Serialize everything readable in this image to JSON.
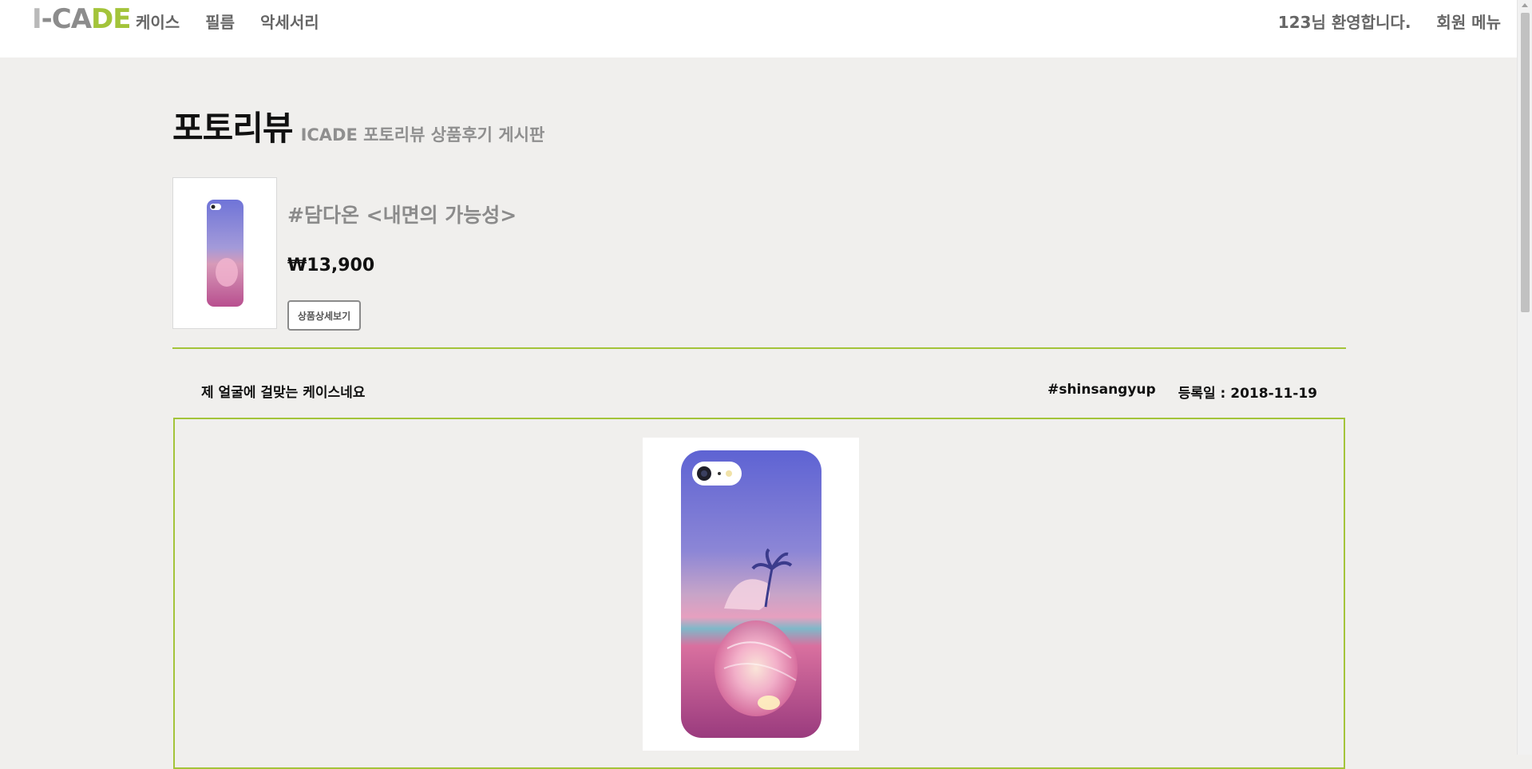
{
  "header": {
    "logo": {
      "part1": "I",
      "part2": "-CA",
      "part3": "DE"
    },
    "nav": [
      "케이스",
      "필름",
      "악세서리"
    ],
    "welcome": "123님 환영합니다.",
    "member_menu": "회원 메뉴"
  },
  "page": {
    "title": "포토리뷰",
    "subtitle": "ICADE 포토리뷰 상품후기 게시판"
  },
  "product": {
    "name": "#담다온 <내면의 가능성>",
    "price": "₩13,900",
    "detail_button": "상품상세보기"
  },
  "review": {
    "title": "제 얼굴에 걸맞는 케이스네요",
    "author": "#shinsangyup",
    "date_label": "등록일 : 2018-11-19"
  },
  "colors": {
    "accent": "#a3c43a",
    "background": "#f0efed"
  }
}
